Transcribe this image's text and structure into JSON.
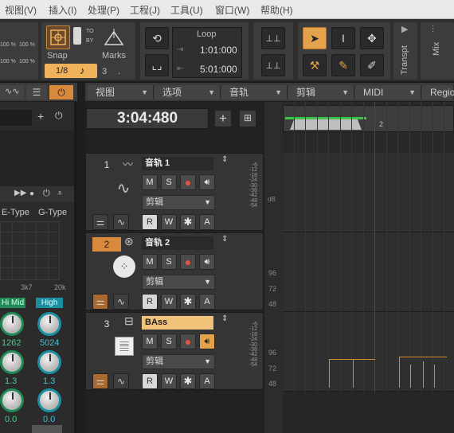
{
  "menu": [
    "视图(V)",
    "插入(I)",
    "处理(P)",
    "工程(J)",
    "工具(U)",
    "窗口(W)",
    "帮助(H)"
  ],
  "toolbar": {
    "snap_label": "Snap",
    "marks_label": "Marks",
    "snap_value": "1/8",
    "snap_num": "3",
    "snap_dot": ".",
    "to_label": "TO",
    "by_label": "BY",
    "loop_label": "Loop",
    "loop_start": "1:01:000",
    "loop_end": "5:01:000",
    "transport_label": "Transpt",
    "mix_label": "Mix",
    "pct_left": [
      "100 %",
      "100 %"
    ],
    "pct_right": [
      "100 %",
      "100 %"
    ]
  },
  "subheader": {
    "dropdowns": [
      "视图",
      "选项",
      "音轨",
      "剪辑",
      "MIDI",
      "Region"
    ]
  },
  "timebar": {
    "time": "3:04:480",
    "ruler_mark": "2"
  },
  "leftpanel": {
    "etype": "E-Type",
    "gtype": "G-Type",
    "freq_left": "3k7",
    "freq_right": "20k",
    "himid_label": "Hi Mid",
    "high_label": "High",
    "himid_freq": "1262",
    "high_freq": "5024",
    "himid_q": "1.3",
    "high_q": "1.3",
    "himid_gain": "0.0",
    "high_gain": "0.0"
  },
  "tracks": [
    {
      "number": "1",
      "name": "音轨 1",
      "clip_label": "剪辑",
      "m": "M",
      "s": "S",
      "r": "R",
      "w": "W",
      "star": "✱",
      "a": "A"
    },
    {
      "number": "2",
      "name": "音轨 2",
      "clip_label": "剪辑",
      "m": "M",
      "s": "S",
      "r": "R",
      "w": "W",
      "star": "✱",
      "a": "A"
    },
    {
      "number": "3",
      "name": "BAss",
      "clip_label": "剪辑",
      "m": "M",
      "s": "S",
      "r": "R",
      "w": "W",
      "star": "✱",
      "a": "A"
    }
  ],
  "meter_scale": [
    "-6",
    "-12",
    "-18",
    "-24",
    "-30",
    "-36",
    "-42",
    "-48",
    "-54"
  ],
  "ruler_values": [
    "96",
    "72",
    "48"
  ],
  "db_label": "dB",
  "colors": {
    "accent": "#f0b25a",
    "selected_orange": "#d9893c",
    "cyan": "#39c4d6",
    "record": "#e05a3a"
  }
}
